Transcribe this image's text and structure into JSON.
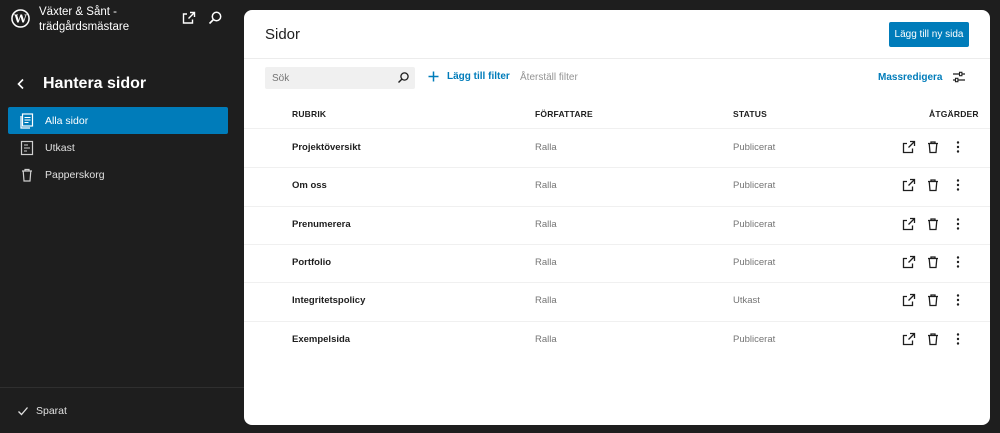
{
  "site": {
    "title": "Växter & Sånt - trädgårdsmästare"
  },
  "sidebar": {
    "heading": "Hantera sidor",
    "items": [
      {
        "label": "Alla sidor",
        "icon": "pages-icon",
        "active": true
      },
      {
        "label": "Utkast",
        "icon": "drafts-icon",
        "active": false
      },
      {
        "label": "Papperskorg",
        "icon": "trash-icon",
        "active": false
      }
    ],
    "footer_status": "Sparat"
  },
  "main": {
    "title": "Sidor",
    "add_button": "Lägg till ny sida",
    "search_placeholder": "Sök",
    "add_filter": "Lägg till filter",
    "reset_filter": "Återställ filter",
    "bulk_edit": "Massredigera",
    "columns": {
      "title": "RUBRIK",
      "author": "FÖRFATTARE",
      "status": "STATUS",
      "actions": "ÅTGÄRDER"
    },
    "rows": [
      {
        "title": "Projektöversikt",
        "author": "Ralla",
        "status": "Publicerat"
      },
      {
        "title": "Om oss",
        "author": "Ralla",
        "status": "Publicerat"
      },
      {
        "title": "Prenumerera",
        "author": "Ralla",
        "status": "Publicerat"
      },
      {
        "title": "Portfolio",
        "author": "Ralla",
        "status": "Publicerat"
      },
      {
        "title": "Integritetspolicy",
        "author": "Ralla",
        "status": "Utkast"
      },
      {
        "title": "Exempelsida",
        "author": "Ralla",
        "status": "Publicerat"
      }
    ]
  },
  "colors": {
    "accent": "#007cba",
    "sidebar_bg": "#1e1e1e",
    "panel_bg": "#ffffff",
    "muted_text": "#757575"
  }
}
